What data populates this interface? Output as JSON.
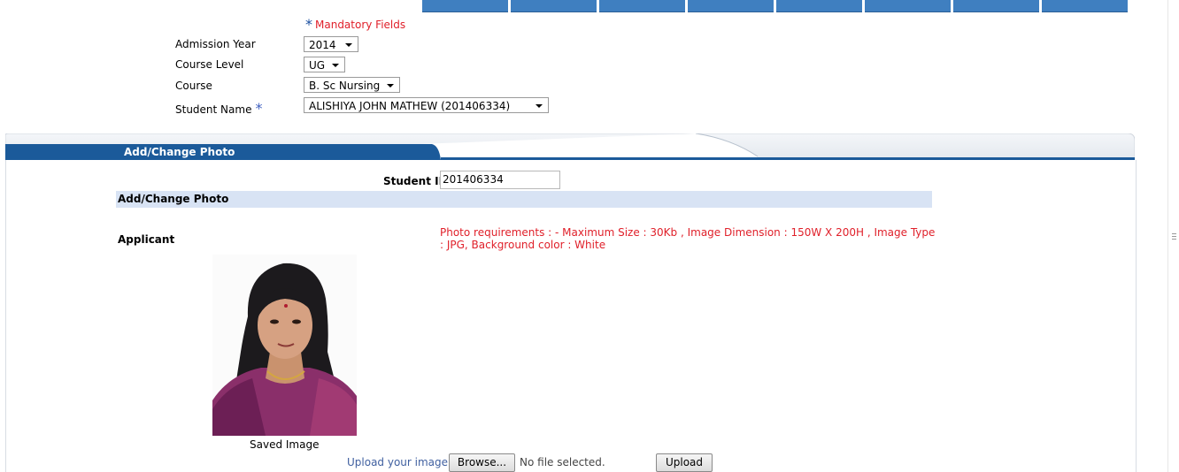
{
  "form": {
    "mandatory_note": "Mandatory Fields",
    "admission_year": {
      "label": "Admission Year",
      "value": "2014"
    },
    "course_level": {
      "label": "Course Level",
      "value": "UG"
    },
    "course": {
      "label": "Course",
      "value": "B. Sc Nursing"
    },
    "student_name": {
      "label": "Student Name",
      "value": "ALISHIYA JOHN MATHEW (201406334)"
    }
  },
  "panel": {
    "title": "Add/Change Photo",
    "student_id_label": "Student ID",
    "student_id_value": "201406334",
    "section_heading": "Add/Change Photo",
    "applicant_label": "Applicant",
    "photo_requirements": "Photo requirements : - Maximum Size : 30Kb , Image Dimension : 150W X 200H , Image Type : JPG, Background color : White",
    "saved_image_caption": "Saved Image",
    "upload_label": "Upload your image",
    "browse_button": "Browse...",
    "no_file_text": "No file selected.",
    "upload_button": "Upload"
  },
  "colors": {
    "accent_blue": "#1b5a9a",
    "required_red": "#e0202a",
    "subhead_bg": "#d8e3f4"
  }
}
